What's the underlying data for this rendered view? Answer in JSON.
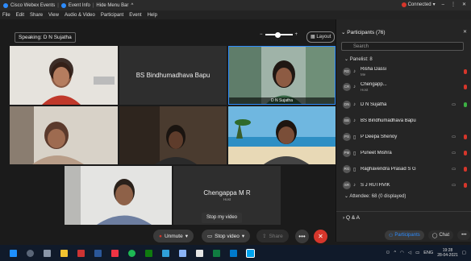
{
  "titlebar": {
    "app_title": "Cisco Webex Events",
    "event_info": "Event Info",
    "hide_menu": "Hide Menu Bar",
    "hide_chevron": "^",
    "status": "Connected",
    "status_chevron": "▾",
    "minimize": "–",
    "options": "⋮",
    "close": "✕"
  },
  "menubar": {
    "items": [
      "File",
      "Edit",
      "Share",
      "View",
      "Audio & Video",
      "Participant",
      "Event",
      "Help"
    ]
  },
  "toolbar": {
    "speaking": "Speaking: D N Sujatha",
    "layout_label": "Layout",
    "zoom_out": "−",
    "zoom_in": "+"
  },
  "tiles": {
    "bs_bindhu_name": "BS Bindhumadhava Bapu",
    "dn_sujatha_label": "D N Sujatha",
    "chengappa_name": "Chengappa M R",
    "chengappa_sub": "Host",
    "stop_video_tip": "Stop my video"
  },
  "controls": {
    "unmute": "Unmute",
    "stop_video": "Stop video",
    "share": "Share",
    "more": "•••",
    "leave": "✕"
  },
  "panel": {
    "title": "Participants (76)",
    "close": "✕",
    "search_placeholder": "Search",
    "panelist_group": "Panelist: 8",
    "attendee_group": "Attendee: 68 (0 displayed)",
    "participants": [
      {
        "initials": "RD",
        "name": "Risha Dassi",
        "role": "Me"
      },
      {
        "initials": "CR",
        "name": "Chengapp...",
        "role": "Host"
      },
      {
        "initials": "DN",
        "name": "D N Sujatha",
        "role": ""
      },
      {
        "initials": "BB",
        "name": "BS Bindhumadhava Bapu",
        "role": ""
      },
      {
        "initials": "PS",
        "name": "P Deepa Shenoy",
        "role": ""
      },
      {
        "initials": "PM",
        "name": "Puneet Mishra",
        "role": ""
      },
      {
        "initials": "RG",
        "name": "Raghavendra Prasad S G",
        "role": ""
      },
      {
        "initials": "SR",
        "name": "S J RUTHVIK",
        "role": ""
      }
    ],
    "qa": "Q & A",
    "participants_btn": "Participants",
    "chat_btn": "Chat",
    "more_btn": "•••"
  },
  "taskbar": {
    "lang": "ENG",
    "time": "19:28",
    "date": "28-04-2021"
  },
  "colors": {
    "accent": "#2d8cff",
    "red": "#d6362b",
    "green": "#3cb043"
  }
}
